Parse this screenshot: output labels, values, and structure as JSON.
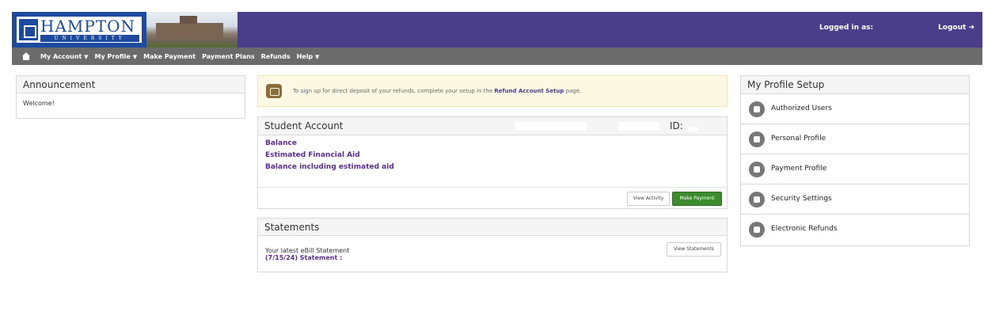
{
  "header": {
    "logo_title": "HAMPTON",
    "logo_subtitle": "UNIVERSITY",
    "logged_in_label": "Logged in as:",
    "logout_label": "Logout"
  },
  "nav": {
    "items": [
      {
        "label": "My Account",
        "has_caret": true
      },
      {
        "label": "My Profile",
        "has_caret": true
      },
      {
        "label": "Make Payment",
        "has_caret": false
      },
      {
        "label": "Payment Plans",
        "has_caret": false
      },
      {
        "label": "Refunds",
        "has_caret": false
      },
      {
        "label": "Help",
        "has_caret": true
      }
    ]
  },
  "announcement": {
    "title": "Announcement",
    "body": "Welcome!"
  },
  "notice": {
    "text_before": "To sign up for direct deposit of your refunds, complete your setup in the",
    "link": "Refund Account Setup",
    "text_after": "page."
  },
  "student_account": {
    "title": "Student Account",
    "id_label": "ID:",
    "links": [
      "Balance",
      "Estimated Financial Aid",
      "Balance including estimated aid"
    ],
    "view_activity": "View Activity",
    "make_payment": "Make Payment"
  },
  "statements": {
    "title": "Statements",
    "latest": "Your latest eBill Statement",
    "statement_line": "(7/15/24) Statement :",
    "view_statements": "View Statements"
  },
  "profile": {
    "title": "My Profile Setup",
    "items": [
      {
        "label": "Authorized Users",
        "icon": "users-icon"
      },
      {
        "label": "Personal Profile",
        "icon": "person-icon"
      },
      {
        "label": "Payment Profile",
        "icon": "credit-card-icon"
      },
      {
        "label": "Security Settings",
        "icon": "lock-icon"
      },
      {
        "label": "Electronic Refunds",
        "icon": "refund-icon"
      }
    ]
  },
  "colors": {
    "header_purple": "#4a3d8a",
    "nav_gray": "#6b6b6b",
    "link_purple": "#5b2d8e",
    "pay_green": "#3d8b2f"
  }
}
